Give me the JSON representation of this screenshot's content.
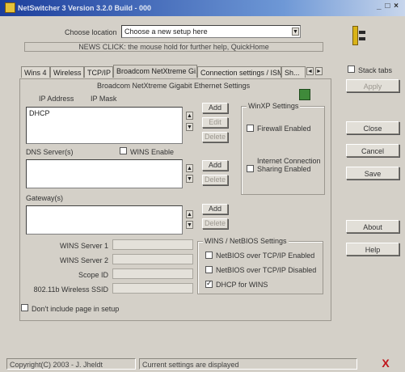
{
  "window": {
    "title": "NetSwitcher 3 Version 3.2.0 Build - 000",
    "minimize_glyph": "_",
    "maximize_glyph": "□",
    "close_glyph": "×",
    "titlebar_color": "#1c3e9c"
  },
  "location": {
    "label": "Choose location",
    "value": "Choose a new setup here"
  },
  "notice": "NEWS CLICK: the mouse hold for further help, QuickHome",
  "tabs": [
    {
      "label": "Wins 4"
    },
    {
      "label": "Wireless"
    },
    {
      "label": "TCP/IP"
    },
    {
      "label": "Broadcom NetXtreme Gi..."
    },
    {
      "label": "Connection settings / ISM"
    },
    {
      "label": "Sh..."
    }
  ],
  "tab_scroll": {
    "left": "◄",
    "right": "►"
  },
  "adapter_label": "Broadcom NetXtreme Gigabit Ethernet Settings",
  "ip": {
    "col_ip": "IP Address",
    "col_mask": "IP Mask",
    "value": "DHCP",
    "add": "Add",
    "edit": "Edit",
    "delete": "Delete"
  },
  "dns": {
    "label": "DNS Server(s)",
    "wins_enable": "WINS Enable",
    "add": "Add",
    "delete": "Delete"
  },
  "gateway": {
    "label": "Gateway(s)",
    "add": "Add",
    "delete": "Delete"
  },
  "winxp": {
    "caption": "WinXP Settings",
    "firewall": "Firewall Enabled",
    "ics": "Internet Connection Sharing Enabled"
  },
  "wins_fields": [
    {
      "label": "WINS Server 1"
    },
    {
      "label": "WINS Server 2"
    },
    {
      "label": "Scope ID"
    },
    {
      "label": "802.11b Wireless SSID"
    }
  ],
  "netbios": {
    "caption": "WINS / NetBIOS Settings",
    "options": [
      {
        "label": "NetBIOS over TCP/IP Enabled",
        "checked": false
      },
      {
        "label": "NetBIOS over TCP/IP Disabled",
        "checked": false
      },
      {
        "label": "DHCP for WINS",
        "checked": true
      }
    ]
  },
  "dont_include": "Don't include page in setup",
  "stack_tabs": "Stack tabs",
  "buttons": {
    "apply": "Apply",
    "close": "Close",
    "cancel": "Cancel",
    "save": "Save",
    "about": "About",
    "help": "Help"
  },
  "status": {
    "copyright": "Copyright(C) 2003 - J. Jheldt",
    "message": "Current settings are displayed",
    "exit_glyph": "X",
    "exit_color": "#c0161c"
  }
}
